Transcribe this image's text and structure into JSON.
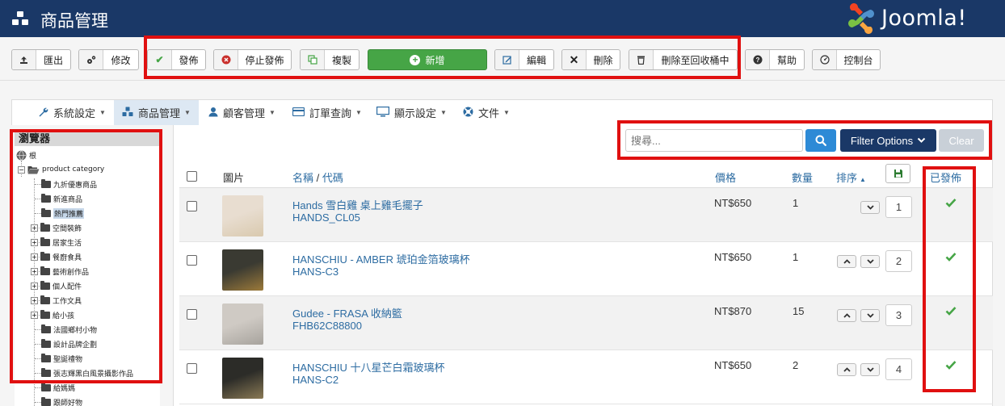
{
  "header": {
    "title": "商品管理",
    "logo_text": "Joomla!"
  },
  "toolbar": {
    "export": "匯出",
    "options": "修改",
    "publish": "發佈",
    "unpublish": "停止發佈",
    "copy": "複製",
    "new": "新增",
    "edit": "編輯",
    "delete": "刪除",
    "trash": "刪除至回收桶中",
    "help": "幫助",
    "dashboard": "控制台"
  },
  "nav": {
    "items": [
      {
        "label": "系統設定",
        "icon": "wrench-icon"
      },
      {
        "label": "商品管理",
        "icon": "cubes-icon",
        "active": true
      },
      {
        "label": "顧客管理",
        "icon": "user-icon"
      },
      {
        "label": "訂單查詢",
        "icon": "credit-card-icon"
      },
      {
        "label": "顯示設定",
        "icon": "monitor-icon"
      },
      {
        "label": "文件",
        "icon": "lifebuoy-icon"
      }
    ]
  },
  "sidebar": {
    "title": "瀏覽器",
    "root": "根",
    "category": "product category",
    "items": [
      {
        "label": "九折優惠商品",
        "expandable": false
      },
      {
        "label": "新進商品",
        "expandable": false
      },
      {
        "label": "熱門推薦",
        "expandable": false,
        "selected": true
      },
      {
        "label": "空間裝飾",
        "expandable": true
      },
      {
        "label": "居家生活",
        "expandable": true
      },
      {
        "label": "餐廚食具",
        "expandable": true
      },
      {
        "label": "藝術創作品",
        "expandable": true
      },
      {
        "label": "個人配件",
        "expandable": true
      },
      {
        "label": "工作文具",
        "expandable": true
      },
      {
        "label": "給小孩",
        "expandable": true
      },
      {
        "label": "法國鄉村小物",
        "expandable": false
      },
      {
        "label": "設計品牌企劃",
        "expandable": false
      },
      {
        "label": "聖誕禮物",
        "expandable": false
      },
      {
        "label": "張志輝黑白風景攝影作品",
        "expandable": false
      },
      {
        "label": "給媽媽",
        "expandable": false
      },
      {
        "label": "跟師好物",
        "expandable": false
      }
    ]
  },
  "search": {
    "placeholder": "搜尋...",
    "filter_label": "Filter Options",
    "clear_label": "Clear"
  },
  "table": {
    "headers": {
      "image": "圖片",
      "name": "名稱",
      "slash": " / ",
      "code": "代碼",
      "price": "價格",
      "quantity": "數量",
      "ordering": "排序",
      "published": "已發佈"
    },
    "rows": [
      {
        "name": "Hands 雪白雞 桌上雞毛擺子",
        "code": "HANDS_CL05",
        "price": "NT$650",
        "qty": "1",
        "order": "1",
        "thumb_colors": [
          "#e8ddd0",
          "#d9c9ae"
        ]
      },
      {
        "name": "HANSCHIU - AMBER 琥珀金箔玻璃杯",
        "code": "HANS-C3",
        "price": "NT$650",
        "qty": "1",
        "order": "2",
        "thumb_colors": [
          "#3a3a32",
          "#9c7a3a"
        ]
      },
      {
        "name": "Gudee - FRASA 收納籃",
        "code": "FHB62C88800",
        "price": "NT$870",
        "qty": "15",
        "order": "3",
        "thumb_colors": [
          "#cfcac4",
          "#a7a39d"
        ]
      },
      {
        "name": "HANSCHIU 十八星芒白霜玻璃杯",
        "code": "HANS-C2",
        "price": "NT$650",
        "qty": "2",
        "order": "4",
        "thumb_colors": [
          "#2c2c28",
          "#8a7a55"
        ]
      }
    ]
  },
  "colors": {
    "header_bg": "#1a3867",
    "accent": "#2d6ca2",
    "success": "#46a546",
    "highlight": "#e01010"
  }
}
